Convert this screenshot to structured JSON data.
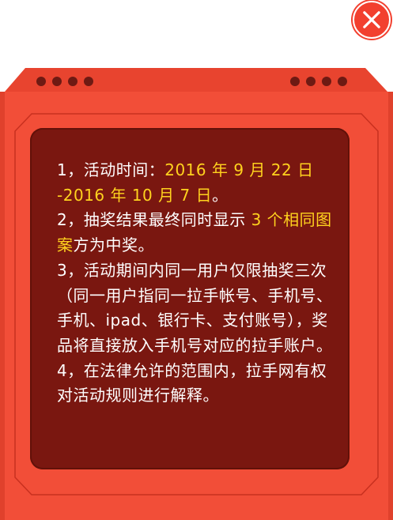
{
  "close": {
    "icon": "close-icon"
  },
  "colors": {
    "frame": "#f04d36",
    "panel": "#7a1710",
    "highlight": "#ffd21e",
    "dots": "#6e1a13"
  },
  "rules": {
    "r1_prefix": "1，活动时间：",
    "r1_dates": "2016 年 9 月 22 日 -2016 年 10 月 7 日",
    "r1_suffix": "。",
    "r2_prefix": "2，抽奖结果最终同时显示 ",
    "r2_highlight": "3 个相同图案",
    "r2_suffix": "方为中奖。",
    "r3": "3，活动期间内同一用户仅限抽奖三次（同一用户指同一拉手帐号、手机号、手机、ipad、银行卡、支付账号），奖品将直接放入手机号对应的拉手账户。",
    "r4": "4，在法律允许的范围内，拉手网有权对活动规则进行解释。"
  }
}
